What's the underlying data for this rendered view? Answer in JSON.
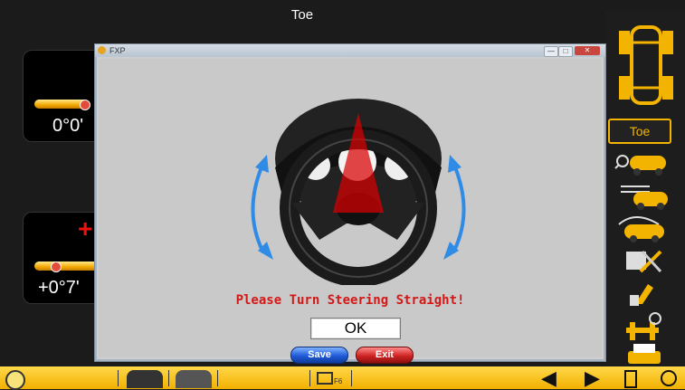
{
  "app": {
    "title": "Toe"
  },
  "left_panels": [
    {
      "value": "0°0'"
    },
    {
      "value": "+0°7'"
    }
  ],
  "right_sidebar": {
    "toe_label": "Toe",
    "buttons": [
      "car-magnify-icon",
      "car-swap-icon",
      "car-wheel-icon",
      "tools-icon",
      "brake-icon",
      "lift-icon",
      "printer-icon"
    ]
  },
  "bottom_bar": {
    "f6_label": "F6"
  },
  "dialog": {
    "title": "FXP",
    "message": "Please Turn Steering Straight!",
    "ok_label": "OK",
    "save_label": "Save",
    "exit_label": "Exit"
  },
  "colors": {
    "accent_yellow": "#f2b400",
    "message_red": "#d41818"
  }
}
